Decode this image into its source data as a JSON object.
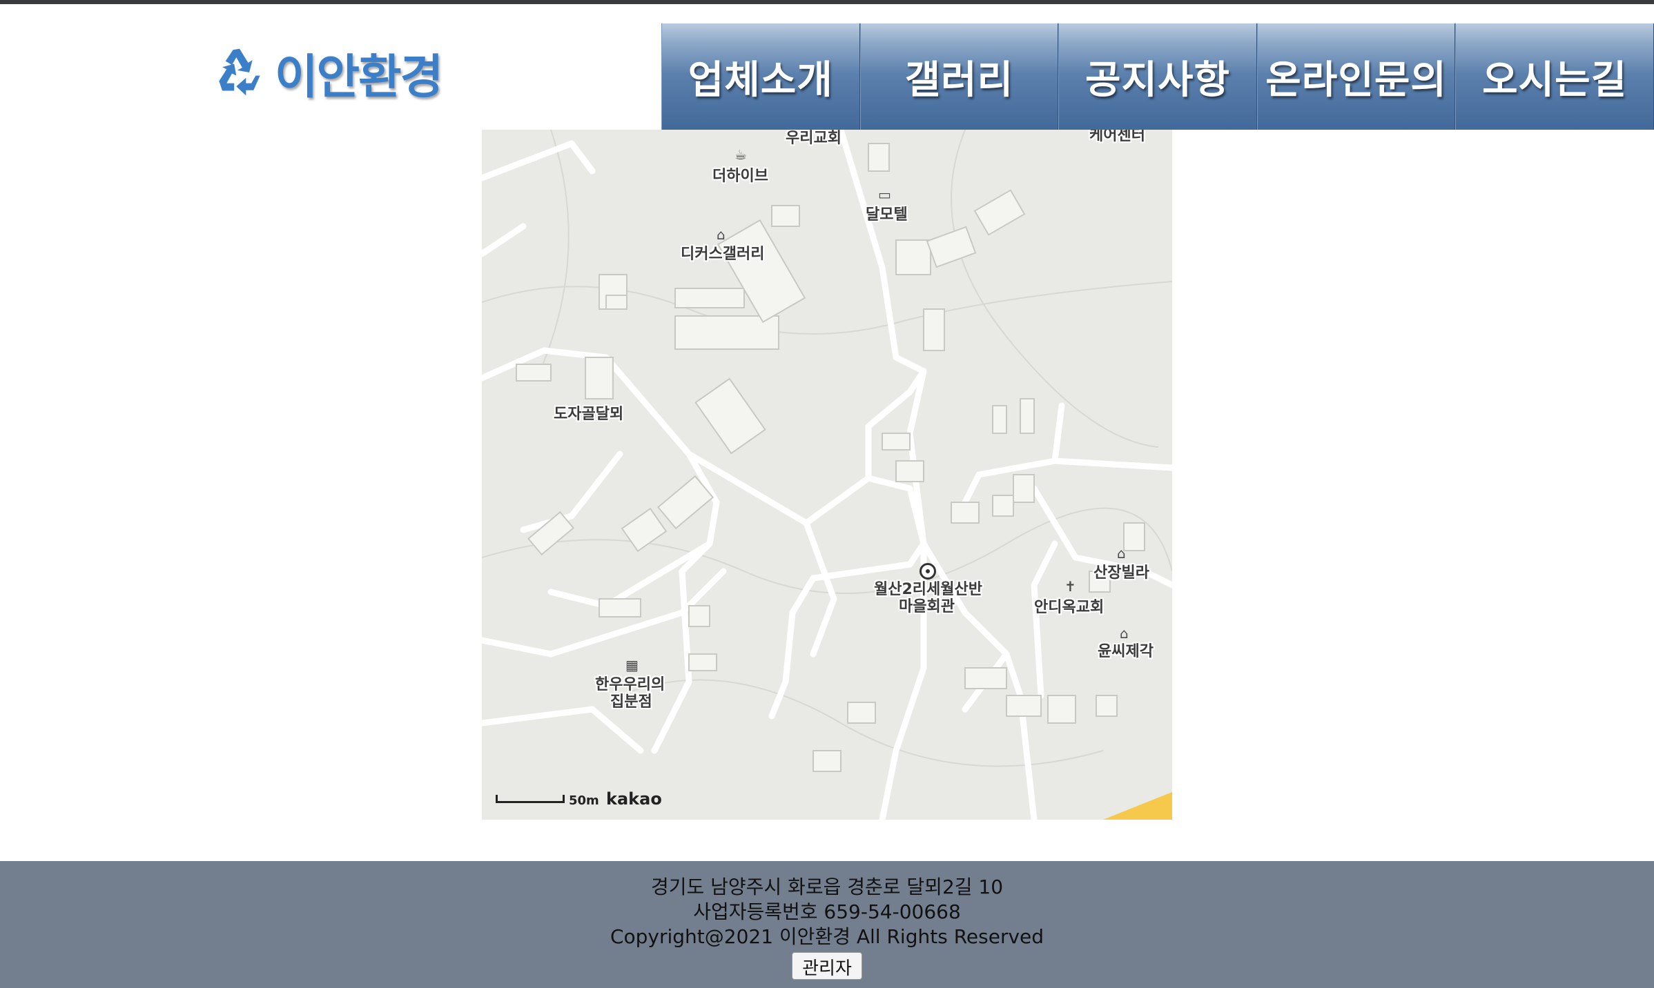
{
  "logo": {
    "text": "이안환경",
    "icon": "recycle-icon",
    "color": "#3c7fc9"
  },
  "nav": {
    "items": [
      {
        "label": "업체소개"
      },
      {
        "label": "갤러리"
      },
      {
        "label": "공지사항"
      },
      {
        "label": "온라인문의"
      },
      {
        "label": "오시는길"
      }
    ]
  },
  "map": {
    "provider": "kakao",
    "scale": "50m",
    "labels": {
      "church_top": "우리교회",
      "care_center": "케어센터",
      "cafe": "더하이브",
      "motel": "달모텔",
      "gallery": "디커스갤러리",
      "area": "도자골달뫼",
      "hall_line1": "월산2리세월산반",
      "hall_line2": "마을회관",
      "villa": "산장빌라",
      "church2": "안디옥교회",
      "craft": "윤씨제각",
      "restaurant_line1": "한우우리의",
      "restaurant_line2": "집분점"
    }
  },
  "footer": {
    "address": "경기도 남양주시 화로읍 경춘로 달뫼2길 10",
    "business_number": "사업자등록번호 659-54-00668",
    "copyright": "Copyright@2021 이안환경 All Rights Reserved",
    "admin_button": "관리자",
    "background": "#737f8f"
  }
}
